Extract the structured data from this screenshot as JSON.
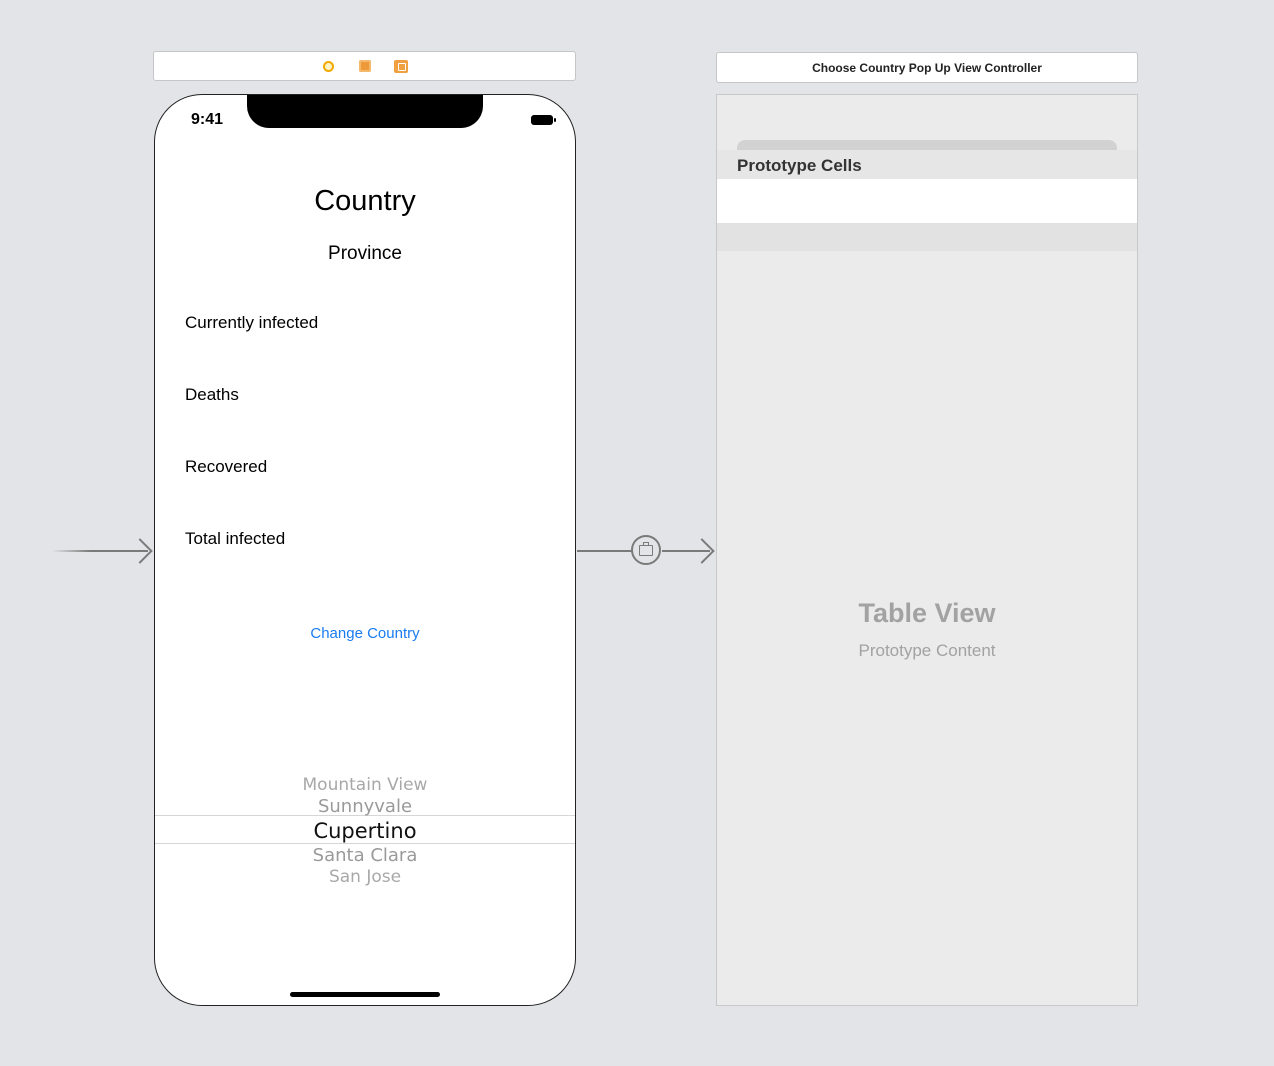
{
  "dock": {
    "icons": [
      "view-controller-icon",
      "first-responder-icon",
      "exit-icon"
    ]
  },
  "phone": {
    "status": {
      "time": "9:41"
    },
    "title": "Country",
    "subtitle": "Province",
    "stats": [
      {
        "label": "Currently infected"
      },
      {
        "label": "Deaths"
      },
      {
        "label": "Recovered"
      },
      {
        "label": "Total infected"
      }
    ],
    "change_button": "Change Country",
    "picker": [
      "Mountain View",
      "Sunnyvale",
      "Cupertino",
      "Santa Clara",
      "San Jose"
    ],
    "picker_selected": "Cupertino"
  },
  "popup": {
    "title": "Choose Country Pop Up View Controller",
    "section_header": "Prototype Cells",
    "placeholder_title": "Table View",
    "placeholder_subtitle": "Prototype Content"
  },
  "colors": {
    "canvas": "#e3e4e7",
    "link": "#1a7cf0",
    "dock_icon": "#f0a040"
  }
}
